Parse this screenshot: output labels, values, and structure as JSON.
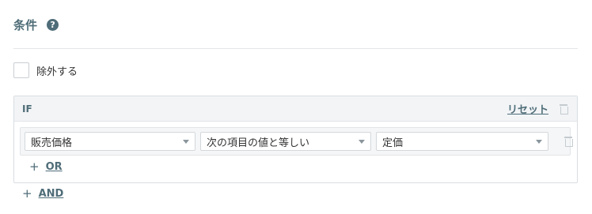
{
  "section": {
    "title": "条件",
    "help_icon_text": "?",
    "help_icon": "help-circle-icon"
  },
  "exclude": {
    "label": "除外する",
    "checked": false
  },
  "if_block": {
    "label": "IF",
    "reset_label": "リセット",
    "delete_icon": "trash-icon",
    "condition": {
      "field": "販売価格",
      "operator": "次の項目の値と等しい",
      "value": "定価",
      "delete_icon": "trash-icon"
    },
    "or_label": "OR",
    "or_plus": "+"
  },
  "and_label": "AND",
  "and_plus": "+",
  "colors": {
    "accent": "#4f6d78",
    "header_bg": "#f2f4f6",
    "border": "#d9dee2"
  }
}
